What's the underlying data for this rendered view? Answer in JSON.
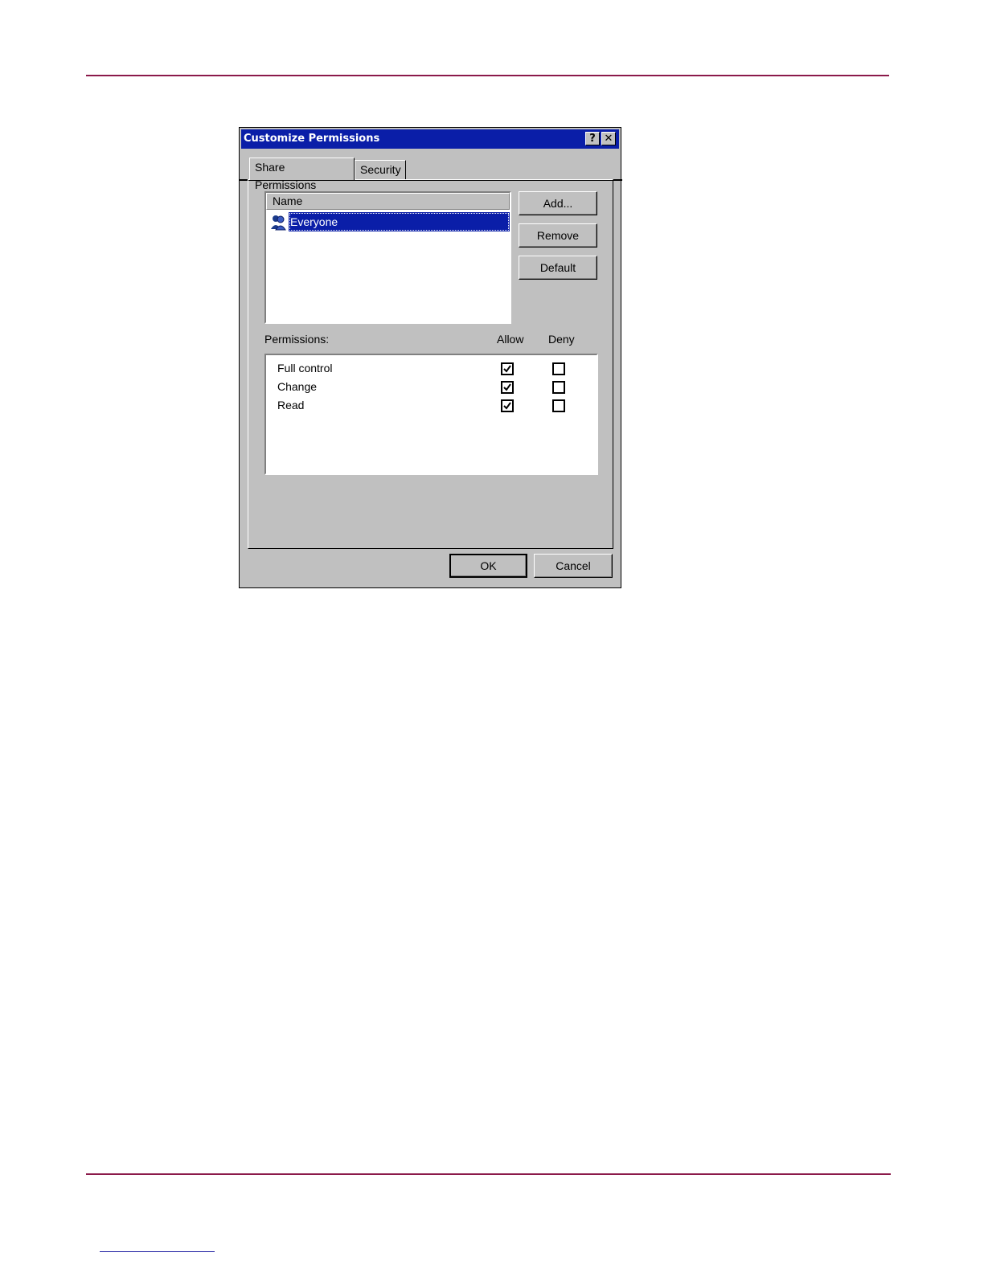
{
  "dialog": {
    "title": "Customize Permissions",
    "help_label": "?",
    "close_label": "✕",
    "tabs": [
      {
        "label": "Share Permissions",
        "active": true
      },
      {
        "label": "Security",
        "active": false
      }
    ],
    "names": {
      "header": "Name",
      "items": [
        {
          "label": "Everyone",
          "icon": "user-group-icon",
          "selected": true
        }
      ]
    },
    "buttons": {
      "add": "Add...",
      "remove": "Remove",
      "default": "Default",
      "ok": "OK",
      "cancel": "Cancel"
    },
    "permissions": {
      "label": "Permissions:",
      "allow_header": "Allow",
      "deny_header": "Deny",
      "rows": [
        {
          "name": "Full control",
          "allow": true,
          "deny": false
        },
        {
          "name": "Change",
          "allow": true,
          "deny": false
        },
        {
          "name": "Read",
          "allow": true,
          "deny": false
        }
      ]
    }
  },
  "colors": {
    "titlebar": "#0a1ea8",
    "page_rule": "#8b1a4a",
    "dialog_face": "#c0c0c0"
  }
}
